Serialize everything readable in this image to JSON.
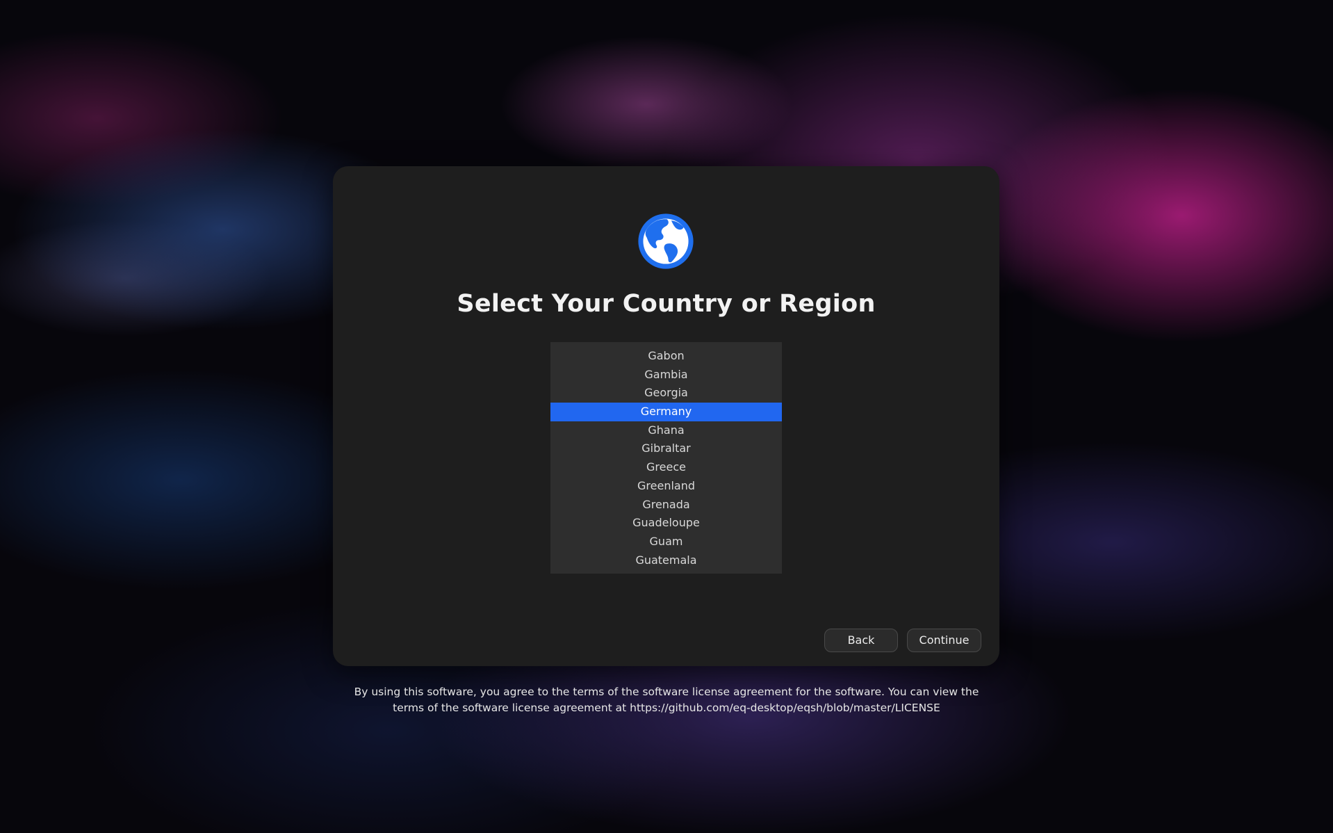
{
  "dialog": {
    "title": "Select Your Country or Region",
    "icon": "globe-icon",
    "accent_color": "#2167f0"
  },
  "country_list": {
    "selected": "Germany",
    "items": [
      "Gabon",
      "Gambia",
      "Georgia",
      "Germany",
      "Ghana",
      "Gibraltar",
      "Greece",
      "Greenland",
      "Grenada",
      "Guadeloupe",
      "Guam",
      "Guatemala"
    ]
  },
  "buttons": {
    "back_label": "Back",
    "continue_label": "Continue"
  },
  "footer": {
    "license_line1": "By using this software, you agree to the terms of the software license agreement for the software. You can view the",
    "license_line2": "terms of the software license agreement at https://github.com/eq-desktop/eqsh/blob/master/LICENSE"
  }
}
